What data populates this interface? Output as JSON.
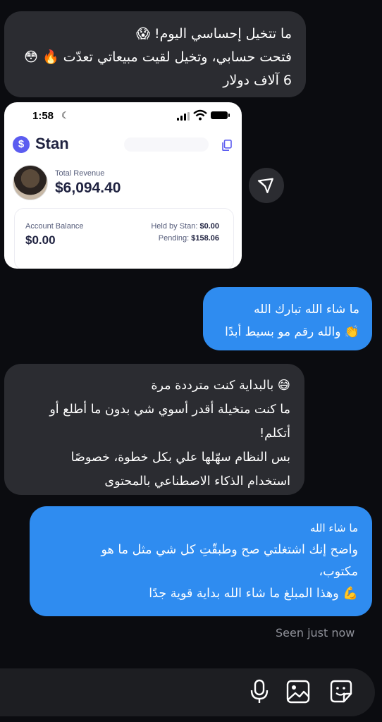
{
  "messages": [
    {
      "id": "m1",
      "from": "other",
      "lines": [
        "ما تتخيل إحساسي اليوم! 😱",
        "فتحت حسابي، وتخيل لقيت مبيعاتي تعدّت 🔥 😳",
        "6 آلاف دولار"
      ]
    },
    {
      "id": "m3",
      "from": "me",
      "lines": [
        "ما شاء الله تبارك الله",
        "👏 والله رقم مو بسيط أبدًا"
      ]
    },
    {
      "id": "m4",
      "from": "other",
      "lines": [
        "😅 بالبداية كنت مترددة مرة",
        "ما كنت متخيلة أقدر أسوي شي بدون ما أطلع أو",
        "أتكلم!",
        "بس النظام سهّلها علي بكل خطوة، خصوصًا",
        "استخدام الذكاء الاصطناعي بالمحتوى"
      ]
    },
    {
      "id": "m5",
      "from": "me",
      "lines": [
        "ما شاء الله",
        "واضح إنك اشتغلتي صح وطبقّتِ كل شي مثل ما هو",
        "مكتوب،",
        "💪 وهذا المبلغ ما شاء الله بداية قوية جدًا"
      ]
    }
  ],
  "shared_screenshot": {
    "status_time": "1:58",
    "app_name": "Stan",
    "logo_symbol": "$",
    "total_revenue_label": "Total Revenue",
    "total_revenue_value": "$6,094.40",
    "account_balance_label": "Account Balance",
    "account_balance_value": "$0.00",
    "held_label": "Held by Stan:",
    "held_value": "$0.00",
    "pending_label": "Pending:",
    "pending_value": "$158.06"
  },
  "seen_status": "Seen just now",
  "composer_icons": [
    "microphone-icon",
    "image-icon",
    "sticker-icon"
  ],
  "colors": {
    "background": "#0b0c10",
    "incoming_bubble": "#2b2c31",
    "outgoing_bubble": "#2f8cf0",
    "brand": "#5b5cf0"
  }
}
